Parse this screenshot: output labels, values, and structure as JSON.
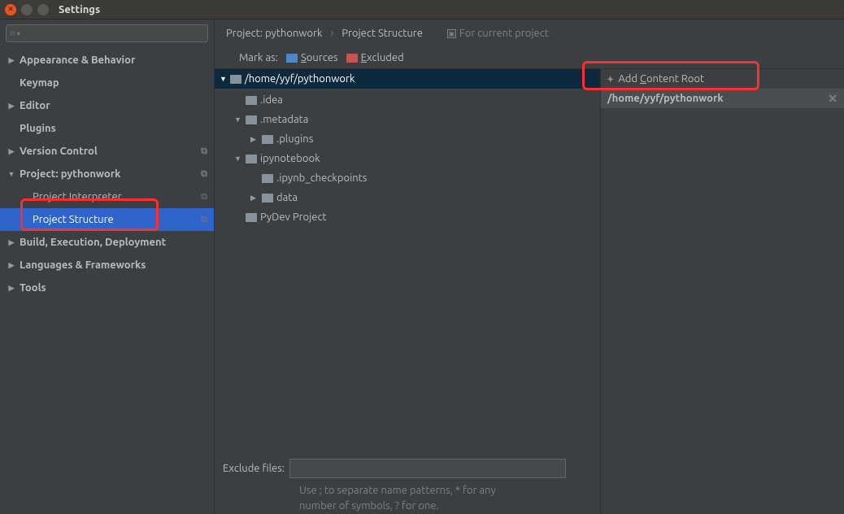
{
  "window": {
    "title": "Settings"
  },
  "sidebar": {
    "search_placeholder": "",
    "items": [
      {
        "label": "Appearance & Behavior",
        "expandable": true
      },
      {
        "label": "Keymap",
        "expandable": false
      },
      {
        "label": "Editor",
        "expandable": true
      },
      {
        "label": "Plugins",
        "expandable": false
      },
      {
        "label": "Version Control",
        "expandable": true,
        "copy": true
      },
      {
        "label": "Project: pythonwork",
        "expandable": true,
        "expanded": true,
        "copy": true
      },
      {
        "label": "Project Interpreter",
        "level": 1,
        "copy": true
      },
      {
        "label": "Project Structure",
        "level": 1,
        "copy": true,
        "selected": true
      },
      {
        "label": "Build, Execution, Deployment",
        "expandable": true
      },
      {
        "label": "Languages & Frameworks",
        "expandable": true
      },
      {
        "label": "Tools",
        "expandable": true
      }
    ]
  },
  "breadcrumb": {
    "crumb1": "Project: pythonwork",
    "crumb2": "Project Structure",
    "badge": "For current project"
  },
  "mark": {
    "label": "Mark as:",
    "sources": "Sources",
    "excluded": "Excluded"
  },
  "folder_tree": {
    "root": "/home/yyf/pythonwork",
    "items": [
      {
        "label": ".idea",
        "indent": 1,
        "arrow": "none"
      },
      {
        "label": ".metadata",
        "indent": 1,
        "arrow": "down"
      },
      {
        "label": ".plugins",
        "indent": 2,
        "arrow": "right"
      },
      {
        "label": "ipynotebook",
        "indent": 1,
        "arrow": "down"
      },
      {
        "label": ".ipynb_checkpoints",
        "indent": 2,
        "arrow": "none"
      },
      {
        "label": "data",
        "indent": 2,
        "arrow": "right"
      },
      {
        "label": "PyDev Project",
        "indent": 1,
        "arrow": "none"
      }
    ]
  },
  "exclude": {
    "label": "Exclude files:",
    "value": "",
    "hint_line1": "Use ; to separate name patterns, * for any",
    "hint_line2": "number of symbols, ? for one."
  },
  "side": {
    "add_label": "Add Content Root",
    "root_path": "/home/yyf/pythonwork"
  }
}
